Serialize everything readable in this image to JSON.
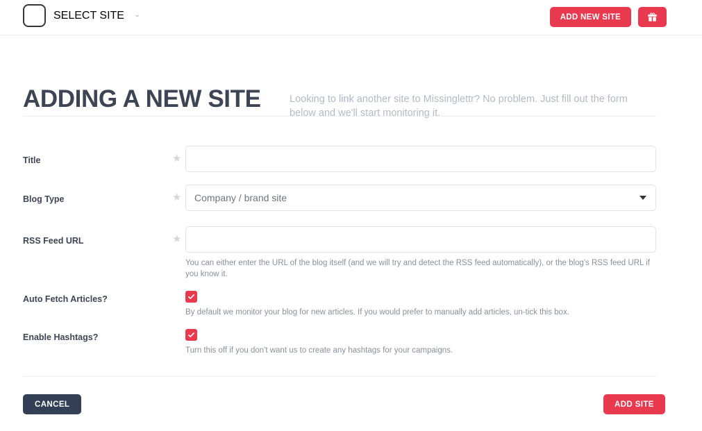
{
  "topbar": {
    "site_selector_label": "SELECT SITE",
    "site_selector_caret": "chevron-down-icon",
    "add_new_site_label": "ADD NEW SITE",
    "gift_button_icon": "gift-icon"
  },
  "header": {
    "title": "ADDING A NEW SITE",
    "subtitle_part1": "Looking to ",
    "subtitle_link": "link",
    "subtitle_part2": " another site to Missinglettr? No problem. Just fill out the form below and we'll start monitoring it."
  },
  "form": {
    "required_star": "★",
    "fields": [
      {
        "label": "Title",
        "type": "text",
        "value": "",
        "placeholder": "",
        "required": true
      },
      {
        "label": "Blog Type",
        "type": "select",
        "value": "Company / brand site",
        "required": true
      },
      {
        "label": "RSS Feed URL",
        "type": "text",
        "value": "",
        "placeholder": "",
        "required": true,
        "help": "You can either enter the URL of the blog itself (and we will try and detect the RSS feed automatically), or the blog's RSS feed URL if you know it."
      },
      {
        "label": "Auto Fetch Articles?",
        "type": "checkbox",
        "checked": true,
        "help": "By default we monitor your blog for new articles. If you would prefer to manually add articles, un-tick this box."
      },
      {
        "label": "Enable Hashtags?",
        "type": "checkbox",
        "checked": true,
        "help": "Turn this off if you don't want us to create any hashtags for your campaigns."
      }
    ]
  },
  "footer": {
    "cancel_label": "CANCEL",
    "submit_label": "ADD SITE"
  },
  "colors": {
    "accent_red": "#e8394e",
    "dark_navy": "#333f54",
    "title_text": "#3d4453",
    "muted_text": "#b4bac4",
    "help_text": "#8a8f99",
    "border": "#e2e3e5"
  }
}
